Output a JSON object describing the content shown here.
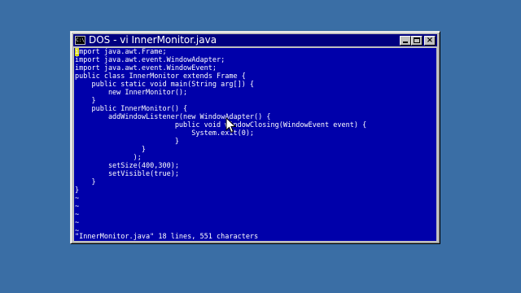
{
  "window": {
    "title": "DOS - vi InnerMonitor.java",
    "icon": "dos-console-icon",
    "icon_text": "C:\\",
    "buttons": {
      "minimize": "minimize-icon",
      "maximize": "maximize-icon",
      "close": "close-icon",
      "close_glyph": "×"
    }
  },
  "editor": {
    "lines": [
      "import java.awt.Frame;",
      "import java.awt.event.WindowAdapter;",
      "import java.awt.event.WindowEvent;",
      "public class InnerMonitor extends Frame {",
      "    public static void main(String arg[]) {",
      "        new InnerMonitor();",
      "    }",
      "    public InnerMonitor() {",
      "        addWindowListener(new WindowAdapter() {",
      "                        public void windowClosing(WindowEvent event) {",
      "                            System.exit(0);",
      "                        }",
      "                }",
      "              );",
      "        setSize(400,300);",
      "        setVisible(true);",
      "    }",
      "}",
      "~",
      "~",
      "~",
      "~",
      "~"
    ],
    "status": "\"InnerMonitor.java\" 18 lines, 551 characters"
  },
  "colors": {
    "desktop": "#3a6ea5",
    "console_bg": "#0000aa",
    "console_fg": "#ffffff",
    "titlebar": "#000080",
    "cursor": "#ffff00"
  }
}
